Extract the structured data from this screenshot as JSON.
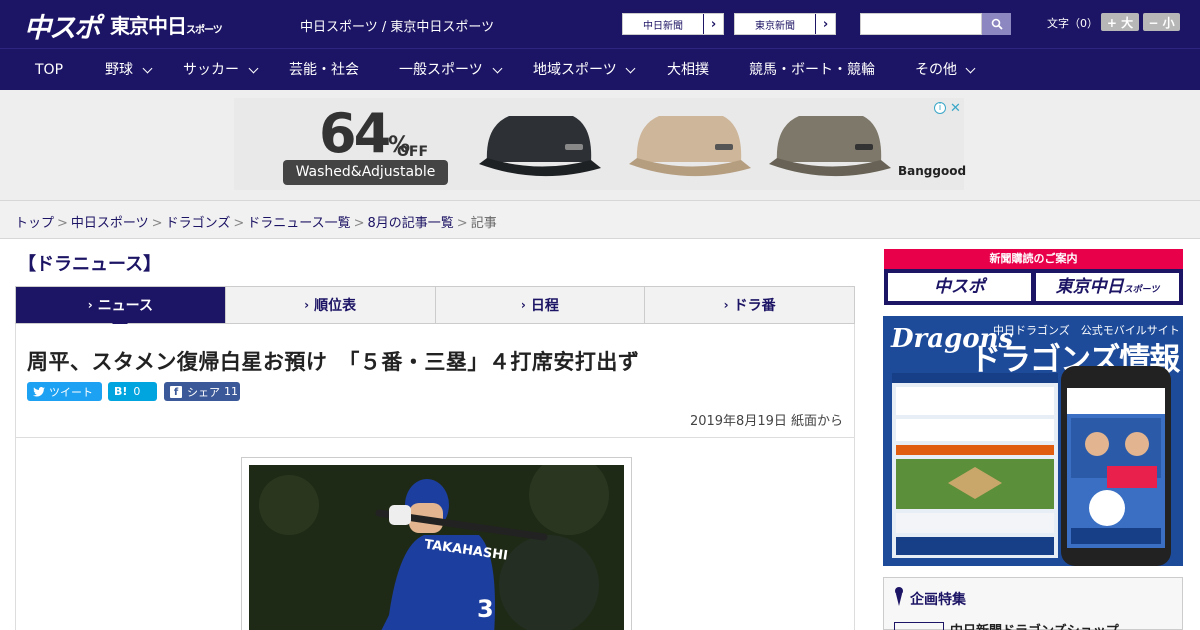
{
  "header": {
    "logo_chuspo": "中スポ",
    "logo_tokyo": "東京中日",
    "logo_tokyo_suffix": "スポーツ",
    "site_names": "中日スポーツ / 東京中日スポーツ",
    "paper_links": [
      "中日新聞",
      "東京新聞"
    ],
    "search_placeholder": "",
    "font_size_label": "文字（0）",
    "font_larger": "+ 大",
    "font_smaller": "− 小"
  },
  "nav": {
    "items": [
      {
        "label": "TOP",
        "has_menu": false
      },
      {
        "label": "野球",
        "has_menu": true
      },
      {
        "label": "サッカー",
        "has_menu": true
      },
      {
        "label": "芸能・社会",
        "has_menu": false
      },
      {
        "label": "一般スポーツ",
        "has_menu": true
      },
      {
        "label": "地域スポーツ",
        "has_menu": true
      },
      {
        "label": "大相撲",
        "has_menu": false
      },
      {
        "label": "競馬・ボート・競輪",
        "has_menu": false
      },
      {
        "label": "その他",
        "has_menu": true
      }
    ]
  },
  "ad": {
    "discount": "64",
    "percent": "%",
    "off": "OFF",
    "tagline": "Washed&Adjustable",
    "brand": "Banggood",
    "info": "i",
    "close": "✕"
  },
  "breadcrumb": [
    "トップ",
    "中日スポーツ",
    "ドラゴンズ",
    "ドラニュース一覧",
    "8月の記事一覧",
    "記事"
  ],
  "section_title": "【ドラニュース】",
  "tabs": [
    {
      "label": "ニュース",
      "active": true
    },
    {
      "label": "順位表",
      "active": false
    },
    {
      "label": "日程",
      "active": false
    },
    {
      "label": "ドラ番",
      "active": false
    }
  ],
  "article": {
    "headline": "周平、スタメン復帰白星お預け　「５番・三塁」４打席安打出ず",
    "share": {
      "tweet": "ツイート",
      "hatena_label": "B!",
      "hatena_count": "0",
      "facebook_label": "シェア",
      "facebook_count": "11"
    },
    "date": "2019年8月19日 紙面から",
    "photo_jersey": "TAKAHASHI",
    "photo_number": "3"
  },
  "sidebar": {
    "subscribe_header": "新聞購読のご案内",
    "subscribe_logos": [
      "中スポ",
      "東京中日"
    ],
    "subscribe_logo_suffix": "スポーツ",
    "dragons_logo": "Dragons",
    "dragons_sub": "中日ドラゴンズ　公式モバイルサイト",
    "dragons_title": "ドラゴンズ情報",
    "feature_title": "企画特集",
    "feature_item": "中日新聞ドラゴンズショップ"
  },
  "colors": {
    "navy": "#1c1464",
    "pink": "#e8004b",
    "twitter": "#1da1f2",
    "hatena": "#00a4de",
    "facebook": "#3b5998"
  }
}
